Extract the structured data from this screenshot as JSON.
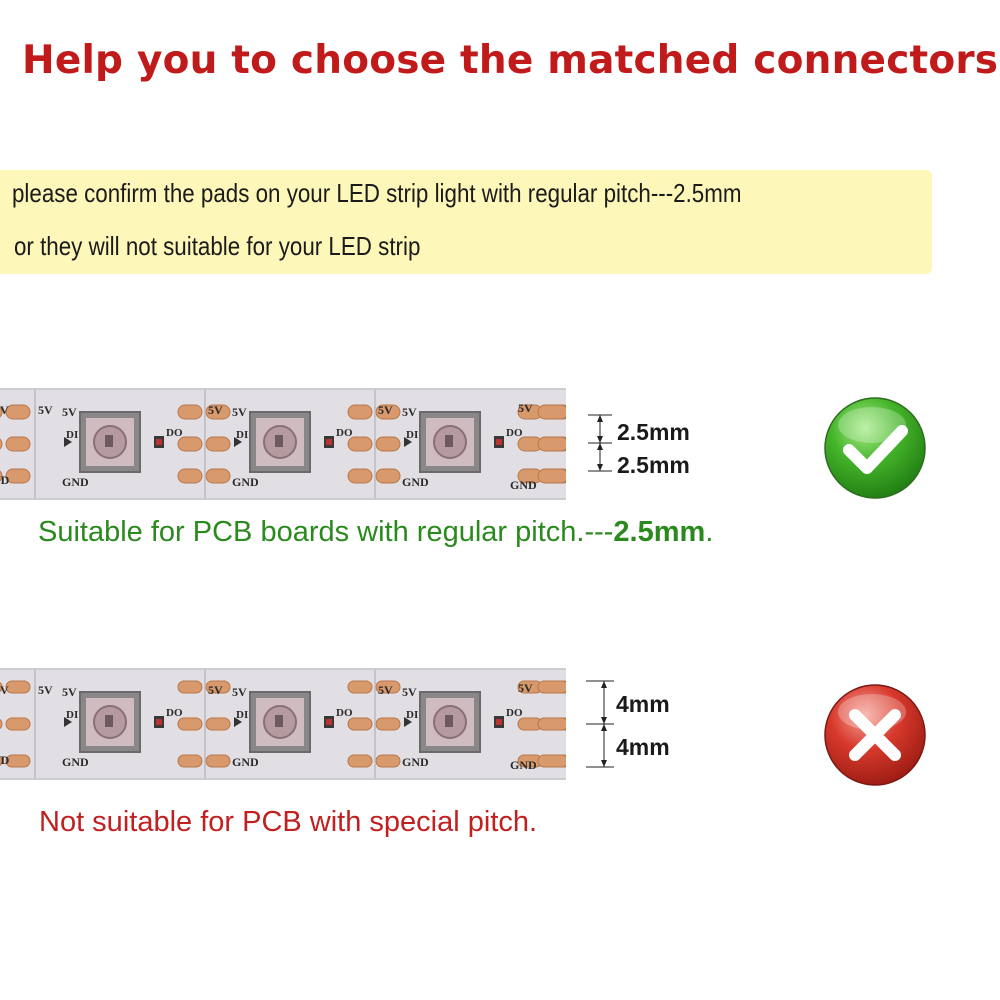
{
  "title": "Help you to choose the matched connectors",
  "note": {
    "line1": "please confirm the pads on your LED strip light  with regular pitch---2.5mm",
    "line2": "or they will not suitable for your LED strip"
  },
  "strip_labels": {
    "v5": "5V",
    "di": "DI",
    "do": "DO",
    "gnd": "GND"
  },
  "section_ok": {
    "dim_top": "2.5mm",
    "dim_bottom": "2.5mm",
    "caption_prefix": "Suitable for PCB boards with regular pitch.---",
    "caption_bold": "2.5mm",
    "caption_suffix": ".",
    "icon": "check-icon",
    "color": "#2a8a1e"
  },
  "section_bad": {
    "dim_top": "4mm",
    "dim_bottom": "4mm",
    "caption": "Not suitable for PCB with special pitch.",
    "icon": "cross-icon",
    "color": "#c21f1f"
  }
}
